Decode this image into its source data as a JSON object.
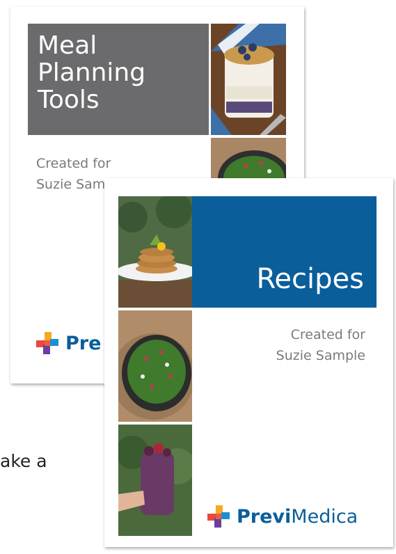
{
  "background_text": "ake a",
  "back_card": {
    "title_lines": [
      "Meal",
      "Planning",
      "Tools"
    ],
    "created_line1": "Created for",
    "created_line2": "Suzie Sam",
    "logo_text": "Pre",
    "title_bg": "#6b6a6c"
  },
  "front_card": {
    "title": "Recipes",
    "created_line1": "Created for",
    "created_line2": "Suzie Sample",
    "logo_bold": "Previ",
    "logo_light": "Medica",
    "title_bg": "#0a5e9a"
  },
  "icons": [
    "previmedica-cross-logo"
  ],
  "colors": {
    "brand_blue": "#0a5e9a",
    "grey": "#6b6a6c"
  }
}
